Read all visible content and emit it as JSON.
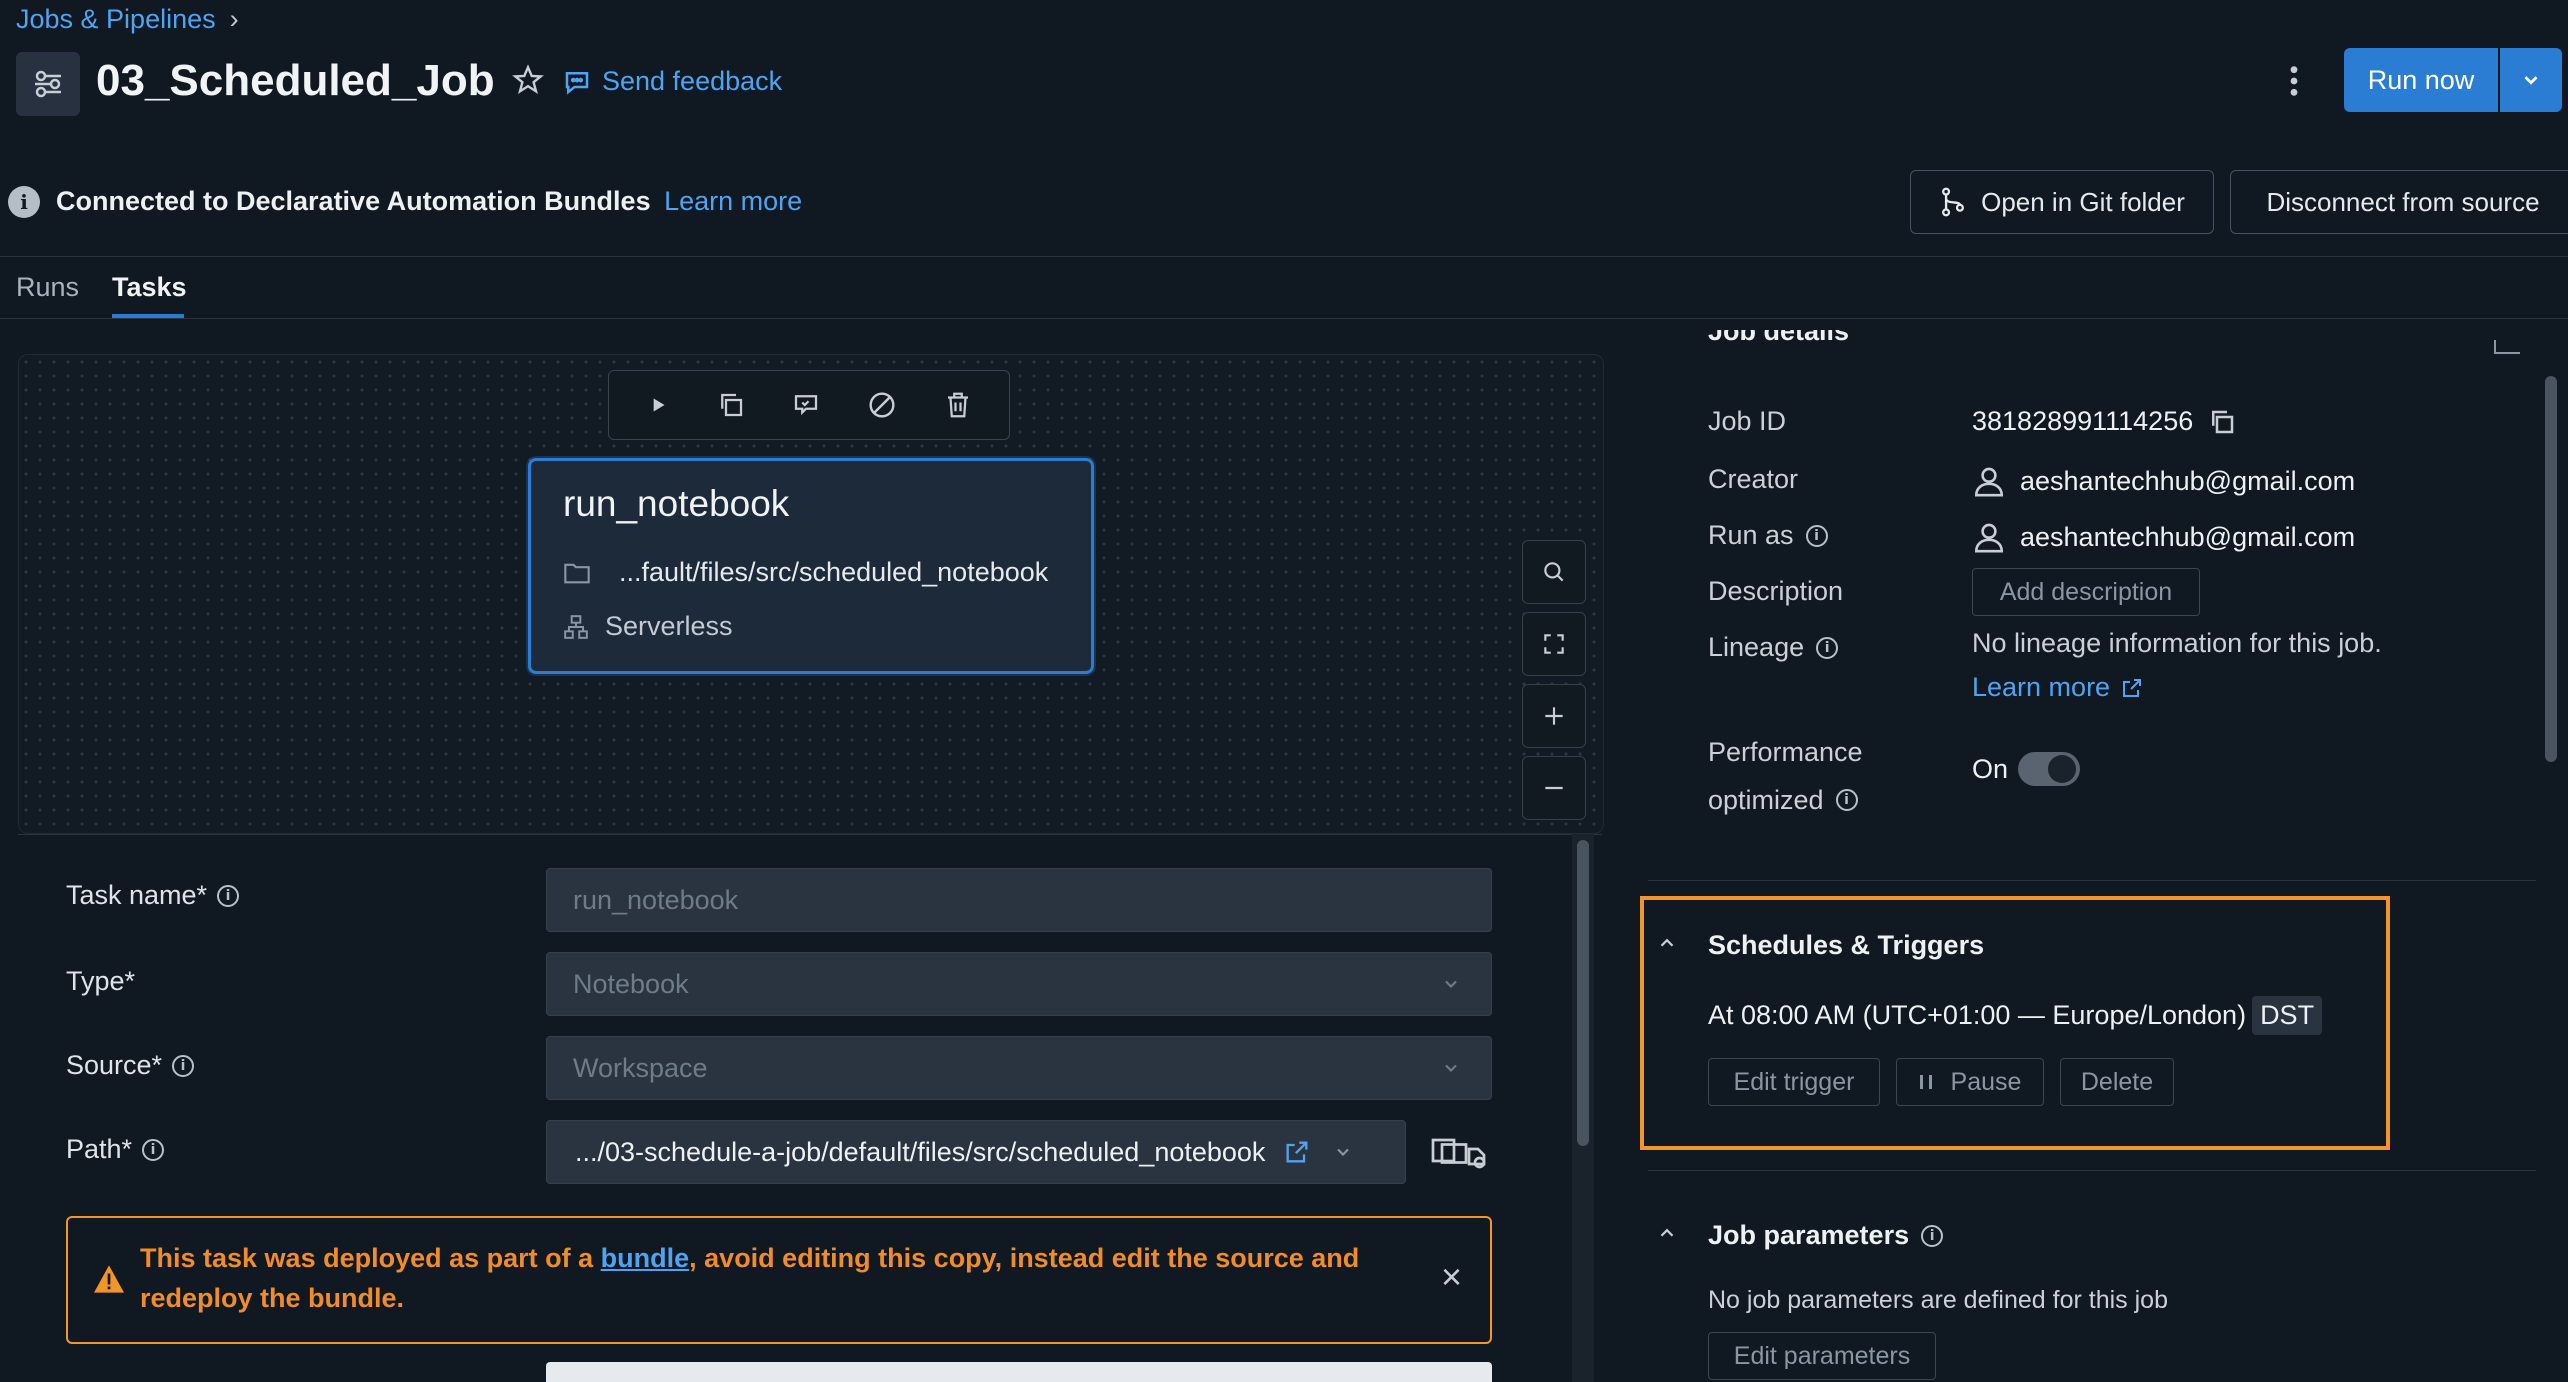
{
  "breadcrumb": {
    "label": "Jobs & Pipelines",
    "separator": "›"
  },
  "header": {
    "title": "03_Scheduled_Job",
    "feedback_label": "Send feedback",
    "run_now_label": "Run now"
  },
  "banner": {
    "text": "Connected to Declarative Automation Bundles",
    "learn_more": "Learn more",
    "open_git_label": "Open in Git folder",
    "disconnect_label": "Disconnect from source"
  },
  "tabs": [
    {
      "label": "Runs",
      "active": false
    },
    {
      "label": "Tasks",
      "active": true
    }
  ],
  "task_node": {
    "name": "run_notebook",
    "path": "...fault/files/src/scheduled_notebook",
    "compute": "Serverless"
  },
  "form": {
    "task_name_label": "Task name*",
    "task_name_value": "run_notebook",
    "type_label": "Type*",
    "type_value": "Notebook",
    "source_label": "Source*",
    "source_value": "Workspace",
    "path_label": "Path*",
    "path_value": ".../03-schedule-a-job/default/files/src/scheduled_notebook"
  },
  "warning": {
    "text_before": "This task was deployed as part of a ",
    "link": "bundle",
    "text_after": ", avoid editing this copy, instead edit the source and",
    "text_line2": "redeploy the bundle.",
    "close": "×"
  },
  "details": {
    "section_title": "Job details",
    "job_id_label": "Job ID",
    "job_id_value": "381828991114256",
    "creator_label": "Creator",
    "creator_value": "aeshantechhub@gmail.com",
    "run_as_label": "Run as",
    "run_as_value": "aeshantechhub@gmail.com",
    "description_label": "Description",
    "add_description": "Add description",
    "lineage_label": "Lineage",
    "lineage_value": "No lineage information for this job.",
    "lineage_learn_more": "Learn more",
    "perf_label_1": "Performance",
    "perf_label_2": "optimized",
    "perf_value": "On"
  },
  "schedules": {
    "title": "Schedules & Triggers",
    "schedule_text": "At 08:00 AM (UTC+01:00 — Europe/London)",
    "dst_badge": "DST",
    "edit_trigger": "Edit trigger",
    "pause": "Pause",
    "delete": "Delete"
  },
  "job_params": {
    "title": "Job parameters",
    "empty_text": "No job parameters are defined for this job",
    "edit_label": "Edit parameters"
  },
  "colors": {
    "accent": "#2b7cd3",
    "highlight_box": "#f0962a",
    "warning_text": "#f08c2b",
    "link": "#4ea4f3",
    "background": "#101821"
  }
}
